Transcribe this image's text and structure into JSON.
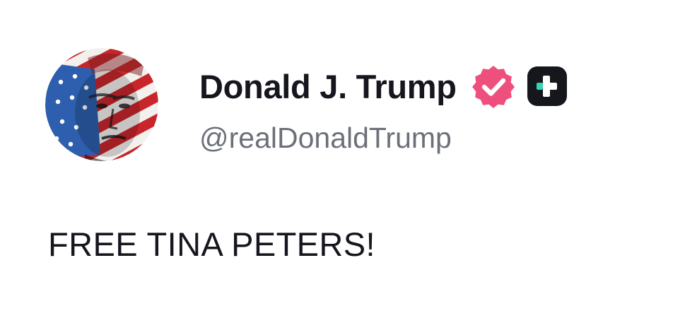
{
  "author": {
    "display_name": "Donald J. Trump",
    "handle": "@realDonaldTrump",
    "verified_icon": "verified-badge-icon",
    "badge_icon": "plus-badge-icon",
    "avatar": "avatar-flag-portrait"
  },
  "post": {
    "text": "FREE TINA PETERS!"
  },
  "colors": {
    "name_text": "#16161f",
    "handle_text": "#6c7079",
    "verified_badge": "#ee4f7d",
    "plus_badge_bg": "#15171c",
    "plus_badge_accent": "#35d4b4",
    "flag_red": "#c8262b",
    "flag_blue": "#2d5fae"
  }
}
